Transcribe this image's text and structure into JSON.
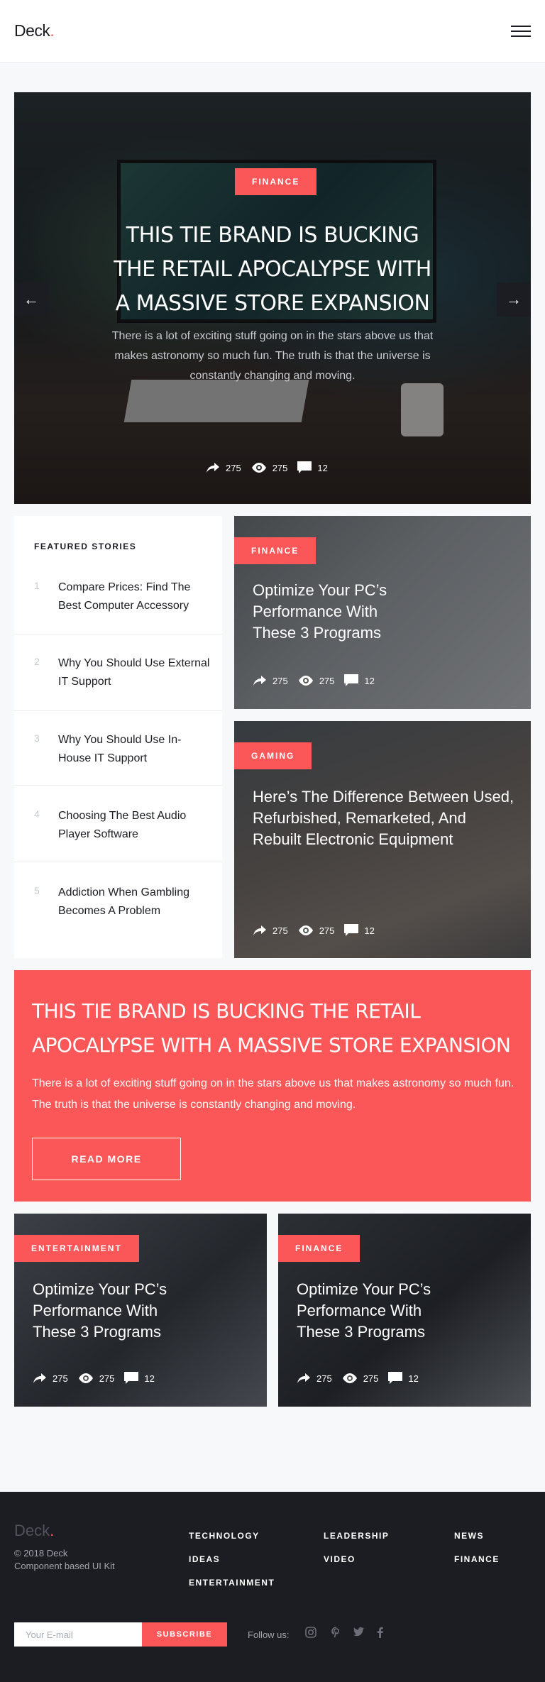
{
  "header": {
    "logo_text": "Deck",
    "logo_dot": "."
  },
  "hero": {
    "category": "FINANCE",
    "title": "THIS TIE BRAND IS BUCKING THE RETAIL APOCALYPSE WITH A MASSIVE STORE EXPANSION",
    "description": "There is a lot of exciting stuff going on in the stars above us that makes astronomy so much fun. The truth is that the universe is constantly changing and moving.",
    "shares": "275",
    "views": "275",
    "comments": "12"
  },
  "featured": {
    "heading": "FEATURED STORIES",
    "items": [
      {
        "num": "1",
        "title": "Compare Prices: Find The Best Computer Accessory"
      },
      {
        "num": "2",
        "title": "Why You Should Use External IT Support"
      },
      {
        "num": "3",
        "title": "Why You Should Use In-House IT Support"
      },
      {
        "num": "4",
        "title": "Choosing The Best Audio Player Software"
      },
      {
        "num": "5",
        "title": "Addiction When Gambling Becomes A Problem"
      }
    ]
  },
  "cards": [
    {
      "category": "FINANCE",
      "title": "Optimize Your PC’s Performance With These 3 Programs",
      "shares": "275",
      "views": "275",
      "comments": "12"
    },
    {
      "category": "GAMING",
      "title": "Here’s The Difference Between Used, Refurbished, Remarketed, And Rebuilt Electronic Equipment",
      "shares": "275",
      "views": "275",
      "comments": "12"
    },
    {
      "category": "ENTERTAINMENT",
      "title": "Optimize Your PC’s Performance With These 3 Programs",
      "shares": "275",
      "views": "275",
      "comments": "12"
    },
    {
      "category": "FINANCE",
      "title": "Optimize Your PC’s Performance With These 3 Programs",
      "shares": "275",
      "views": "275",
      "comments": "12"
    }
  ],
  "promo": {
    "title": "THIS TIE BRAND IS BUCKING THE RETAIL APOCALYPSE WITH A MASSIVE STORE EXPANSION",
    "description": "There is a lot of exciting stuff going on in the stars above us that makes astronomy so much fun. The truth is that the universe is constantly changing and moving.",
    "button": "READ MORE"
  },
  "footer": {
    "logo_text": "Deck",
    "logo_dot": ".",
    "copyright": "© 2018 Deck",
    "tagline": "Component based UI Kit",
    "links": [
      "TECHNOLOGY",
      "IDEAS",
      "ENTERTAINMENT",
      "LEADERSHIP",
      "VIDEO",
      "NEWS",
      "FINANCE"
    ],
    "email_placeholder": "Your E-mail",
    "subscribe": "SUBSCRIBE",
    "follow": "Follow us:"
  },
  "colors": {
    "accent": "#fb5758",
    "dark": "#1c1d22",
    "background": "#f7f8fa"
  }
}
